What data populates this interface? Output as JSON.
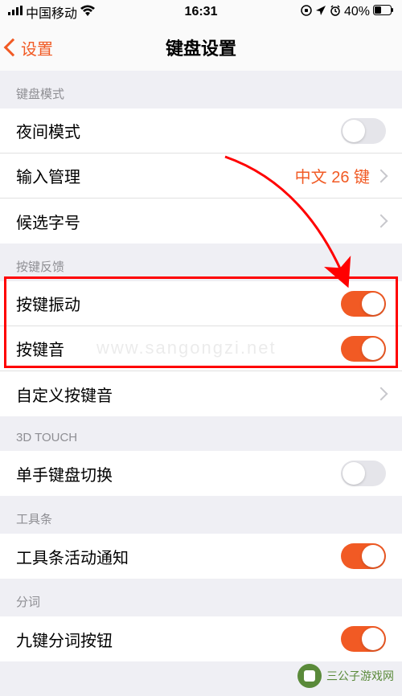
{
  "status_bar": {
    "carrier": "中国移动",
    "time": "16:31",
    "battery": "40%"
  },
  "nav": {
    "back": "设置",
    "title": "键盘设置"
  },
  "sections": {
    "mode": {
      "header": "键盘模式"
    },
    "feedback": {
      "header": "按键反馈"
    },
    "touch3d": {
      "header": "3D TOUCH"
    },
    "toolbar": {
      "header": "工具条"
    },
    "segment": {
      "header": "分词"
    }
  },
  "rows": {
    "night_mode": {
      "label": "夜间模式",
      "on": false
    },
    "input_mgmt": {
      "label": "输入管理",
      "value": "中文 26 键"
    },
    "candidate": {
      "label": "候选字号"
    },
    "vibrate": {
      "label": "按键振动",
      "on": true
    },
    "sound": {
      "label": "按键音",
      "on": true
    },
    "custom_sound": {
      "label": "自定义按键音"
    },
    "onehand": {
      "label": "单手键盘切换",
      "on": false
    },
    "toolbar_notif": {
      "label": "工具条活动通知",
      "on": true
    },
    "nine_segment": {
      "label": "九键分词按钮",
      "on": true
    }
  },
  "watermark": {
    "text": "三公子游戏网",
    "faint": "www.sangongzi.net"
  }
}
